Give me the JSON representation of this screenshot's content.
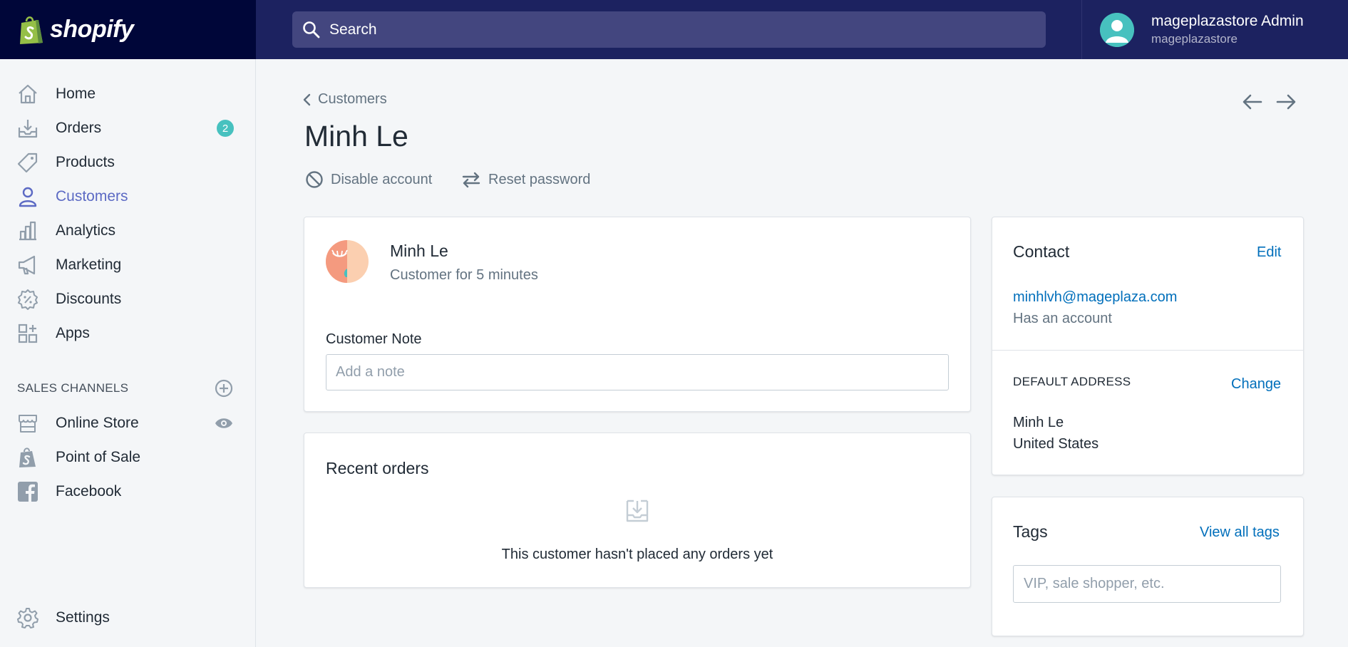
{
  "brand": {
    "name": "shopify"
  },
  "search": {
    "placeholder": "Search"
  },
  "user": {
    "name": "mageplazastore Admin",
    "store": "mageplazastore"
  },
  "sidebar": {
    "items": [
      {
        "label": "Home",
        "icon": "home-icon"
      },
      {
        "label": "Orders",
        "icon": "orders-icon",
        "badge": "2"
      },
      {
        "label": "Products",
        "icon": "tag-icon"
      },
      {
        "label": "Customers",
        "icon": "person-icon",
        "active": true
      },
      {
        "label": "Analytics",
        "icon": "bar-chart-icon"
      },
      {
        "label": "Marketing",
        "icon": "megaphone-icon"
      },
      {
        "label": "Discounts",
        "icon": "discount-icon"
      },
      {
        "label": "Apps",
        "icon": "apps-icon"
      }
    ],
    "sales_channels_heading": "SALES CHANNELS",
    "channels": [
      {
        "label": "Online Store",
        "icon": "store-icon"
      },
      {
        "label": "Point of Sale",
        "icon": "shopify-bag-icon"
      },
      {
        "label": "Facebook",
        "icon": "facebook-icon"
      }
    ],
    "settings_label": "Settings"
  },
  "page": {
    "breadcrumb": "Customers",
    "title": "Minh Le",
    "actions": {
      "disable": "Disable account",
      "reset": "Reset password"
    }
  },
  "customer_card": {
    "name": "Minh Le",
    "since": "Customer for 5 minutes",
    "note_label": "Customer Note",
    "note_placeholder": "Add a note"
  },
  "recent_orders": {
    "title": "Recent orders",
    "empty_text": "This customer hasn't placed any orders yet"
  },
  "contact": {
    "title": "Contact",
    "edit": "Edit",
    "email": "minhlvh@mageplaza.com",
    "account_status": "Has an account",
    "default_address_heading": "DEFAULT ADDRESS",
    "change": "Change",
    "address_lines": [
      "Minh Le",
      "United States"
    ]
  },
  "tags": {
    "title": "Tags",
    "view_all": "View all tags",
    "placeholder": "VIP, sale shopper, etc."
  },
  "colors": {
    "topbar": "#1c2260",
    "logo_bg": "#000639",
    "accent": "#5c6ac4",
    "link": "#006fbb",
    "badge": "#47c1bf"
  }
}
